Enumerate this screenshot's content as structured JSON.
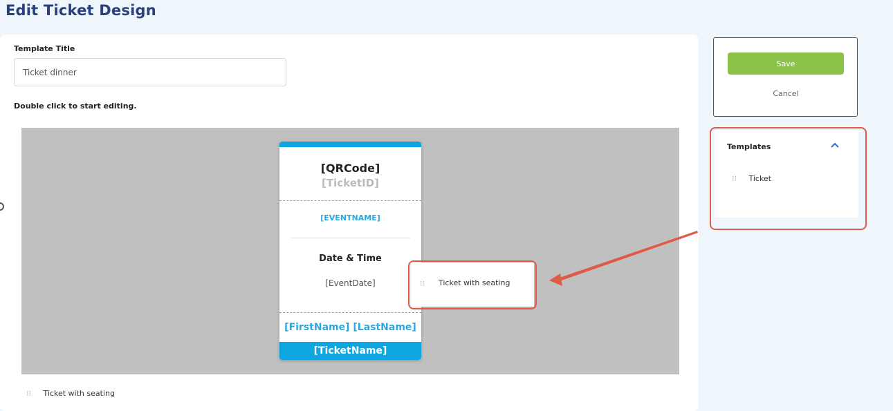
{
  "page": {
    "title": "Edit Ticket Design"
  },
  "form": {
    "template_title_label": "Template Title",
    "template_title_value": "Ticket dinner",
    "hint": "Double click to start editing."
  },
  "ticket": {
    "qr": "[QRCode]",
    "ticket_id": "[TicketID]",
    "event_name": "[EVENTNAME]",
    "date_time_label": "Date & Time",
    "event_date": "[EventDate]",
    "attendee_name": "[FirstName] [LastName]",
    "ticket_name": "[TicketName]"
  },
  "drag_item": {
    "label": "Ticket with seating",
    "grip": "⁝⁝"
  },
  "footer_item": {
    "label": "Ticket with seating",
    "grip": "⁝⁝"
  },
  "actions": {
    "save_label": "Save",
    "cancel_label": "Cancel"
  },
  "templates": {
    "title": "Templates",
    "items": [
      {
        "label": "Ticket",
        "grip": "⁝⁝"
      }
    ]
  },
  "colors": {
    "accent": "#0ea5e0",
    "highlight": "#e05a48",
    "save": "#8bc34a",
    "title": "#2b3f7a"
  }
}
